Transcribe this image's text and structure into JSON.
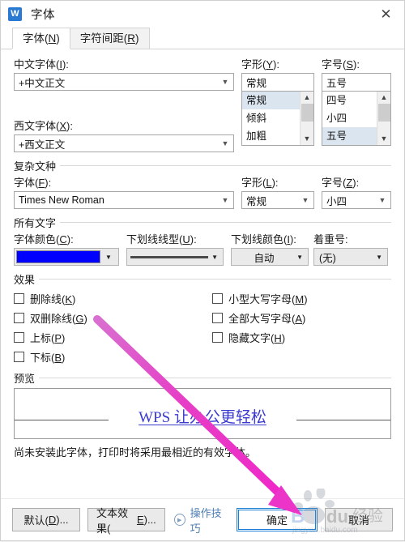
{
  "window": {
    "title": "字体",
    "app_icon": "wps-logo-icon",
    "app_icon_glyph": "W",
    "close_icon": "✕"
  },
  "tabs": [
    {
      "label": "字体(N)",
      "active": true
    },
    {
      "label": "字符间距(R)",
      "active": false
    }
  ],
  "latin_section": {
    "chinese_font": {
      "label": "中文字体(I):",
      "value": "+中文正文"
    },
    "western_font": {
      "label": "西文字体(X):",
      "value": "+西文正文"
    },
    "style": {
      "label": "字形(Y):",
      "value": "常规",
      "options": [
        "常规",
        "倾斜",
        "加粗"
      ],
      "selected": "常规"
    },
    "size": {
      "label": "字号(S):",
      "value": "五号",
      "options": [
        "四号",
        "小四",
        "五号"
      ],
      "selected": "五号"
    }
  },
  "complex_section": {
    "group_label": "复杂文种",
    "font": {
      "label": "字体(F):",
      "value": "Times New Roman"
    },
    "style": {
      "label": "字形(L):",
      "value": "常规"
    },
    "size": {
      "label": "字号(Z):",
      "value": "小四"
    }
  },
  "all_text_section": {
    "group_label": "所有文字",
    "font_color": {
      "label": "字体颜色(C):",
      "value_color": "#0000FF"
    },
    "underline_style": {
      "label": "下划线线型(U):",
      "value": ""
    },
    "underline_color": {
      "label": "下划线颜色(I):",
      "value": "自动"
    },
    "emphasis_mark": {
      "label": "着重号:",
      "value": "(无)"
    }
  },
  "effects_section": {
    "group_label": "效果",
    "left_items": [
      {
        "label": "删除线(K)",
        "checked": false
      },
      {
        "label": "双删除线(G)",
        "checked": false
      },
      {
        "label": "上标(P)",
        "checked": false
      },
      {
        "label": "下标(B)",
        "checked": false
      }
    ],
    "right_items": [
      {
        "label": "小型大写字母(M)",
        "checked": false
      },
      {
        "label": "全部大写字母(A)",
        "checked": false
      },
      {
        "label": "隐藏文字(H)",
        "checked": false
      }
    ]
  },
  "preview_section": {
    "group_label": "预览",
    "sample_text": "WPS 让办公更轻松",
    "sample_color": "#3a3ad0",
    "note": "尚未安装此字体，打印时将采用最相近的有效字体。"
  },
  "footer": {
    "default_button": "默认(D)...",
    "text_effects_button": "文本效果(E)...",
    "tips_link": "操作技巧",
    "ok_button": "确定",
    "cancel_button": "取消"
  },
  "annotation": {
    "arrow_color": "#ec35c8",
    "points_to": "确定"
  },
  "watermark": {
    "text": "Baidu 经验",
    "sub_text": "jingyan.baidu.com"
  }
}
